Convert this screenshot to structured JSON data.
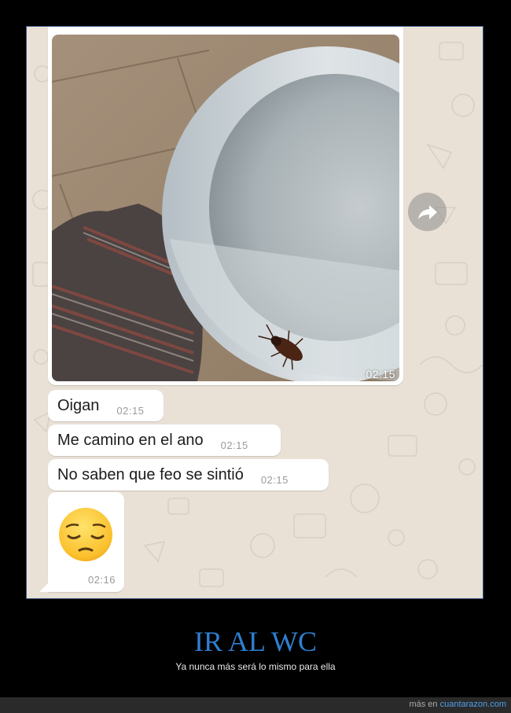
{
  "messages": {
    "image_time": "02:15",
    "texts": [
      {
        "text": "Oigan",
        "time": "02:15"
      },
      {
        "text": "Me camino en el ano",
        "time": "02:15"
      },
      {
        "text": "No saben que feo se sintió",
        "time": "02:15"
      }
    ],
    "emoji_time": "02:16",
    "emoji_name": "pensive-face-emoji"
  },
  "caption": {
    "title": "IR AL WC",
    "subtitle": "Ya nunca más será lo mismo para ella"
  },
  "footer": {
    "prefix": "más en",
    "site": "cuantarazon.com"
  },
  "colors": {
    "chat_background": "#e9e1d6",
    "title": "#2f7fd0",
    "link": "#4ea0e8"
  }
}
